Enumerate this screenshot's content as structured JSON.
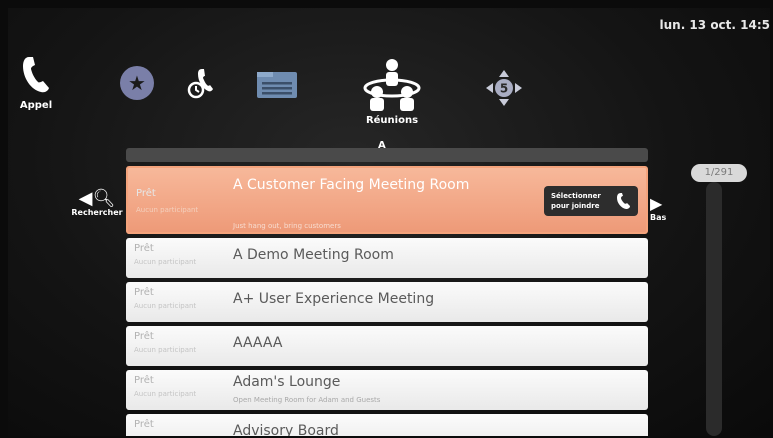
{
  "header": {
    "clock": "lun. 13 oct. 14:5"
  },
  "nav": {
    "appel_label": "Appel",
    "reunions_label": "Réunions",
    "dpad_number": "5"
  },
  "list_top_letter": "A",
  "search": {
    "label": "Rechercher"
  },
  "down": {
    "label": "Bas"
  },
  "pager": {
    "text": "1/291"
  },
  "select_button": {
    "line1": "Sélectionner",
    "line2": "pour joindre"
  },
  "meetings": [
    {
      "status": "Prêt",
      "participants": "Aucun participant",
      "name": "A Customer Facing Meeting Room",
      "description": "Just hang out, bring customers"
    },
    {
      "status": "Prêt",
      "participants": "Aucun participant",
      "name": "A Demo Meeting Room",
      "description": ""
    },
    {
      "status": "Prêt",
      "participants": "Aucun participant",
      "name": "A+ User Experience Meeting",
      "description": ""
    },
    {
      "status": "Prêt",
      "participants": "Aucun participant",
      "name": "AAAAA",
      "description": ""
    },
    {
      "status": "Prêt",
      "participants": "Aucun participant",
      "name": "Adam's Lounge",
      "description": "Open Meeting Room for Adam and Guests"
    },
    {
      "status": "Prêt",
      "participants": "",
      "name": "Advisory Board",
      "description": ""
    }
  ],
  "colors": {
    "selected_row": "#f0a07c",
    "row": "#f2f2f2",
    "background": "#141414"
  }
}
